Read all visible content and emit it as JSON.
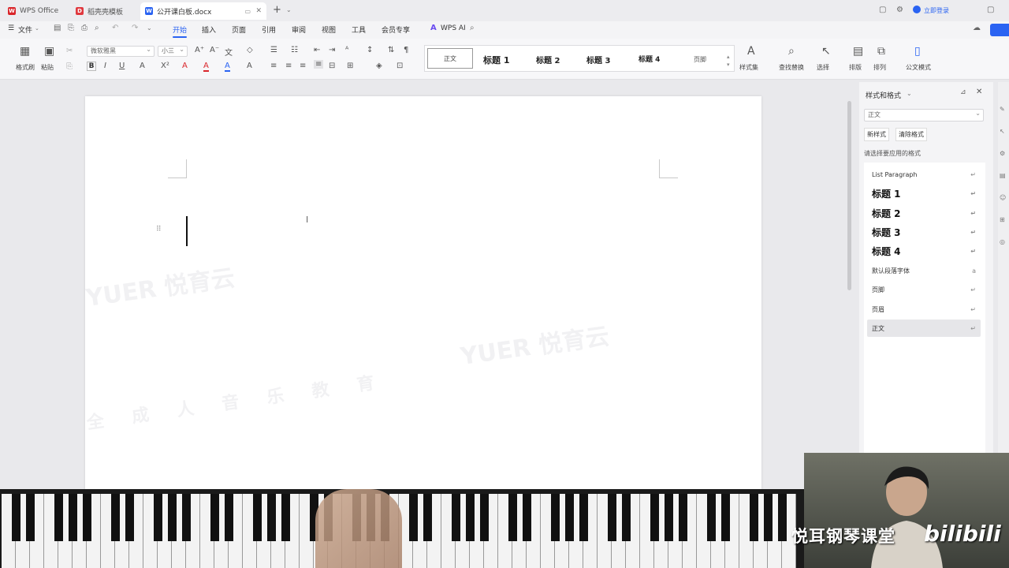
{
  "tabs": [
    {
      "label": "WPS Office",
      "icon": "wps-logo-icon",
      "color": "#d9252a"
    },
    {
      "label": "稻壳壳模板",
      "icon": "docer-icon",
      "color": "#e0383e"
    },
    {
      "label": "公开课白板.docx",
      "icon": "word-doc-icon",
      "color": "#2a63f2",
      "active": true
    }
  ],
  "window_controls": {
    "login": "立即登录"
  },
  "menu": {
    "file": "文件",
    "items": [
      "开始",
      "插入",
      "页面",
      "引用",
      "审阅",
      "视图",
      "工具",
      "会员专享"
    ],
    "active": "开始",
    "wps_ai": "WPS AI"
  },
  "ribbon": {
    "format_painter": "格式刷",
    "paste": "粘贴",
    "font_name": "微软雅黑",
    "font_size": "小三",
    "styles": [
      "正文",
      "标题 1",
      "标题 2",
      "标题 3",
      "标题 4",
      "页脚"
    ],
    "style_set": "样式集",
    "find_replace": "查找替换",
    "select": "选择",
    "sort": "排版",
    "arrange": "排列",
    "official": "公文模式"
  },
  "panel": {
    "title": "样式和格式",
    "current_style": "正文",
    "new_style": "新样式",
    "clear_format": "清除格式",
    "hint": "请选择要应用的格式",
    "items": [
      {
        "label": "List Paragraph",
        "mark": "↵"
      },
      {
        "label": "标题 1",
        "mark": "↵",
        "heading": true
      },
      {
        "label": "标题 2",
        "mark": "↵",
        "heading": true
      },
      {
        "label": "标题 3",
        "mark": "↵",
        "heading": true
      },
      {
        "label": "标题 4",
        "mark": "↵",
        "heading": true
      },
      {
        "label": "默认段落字体",
        "mark": "a"
      },
      {
        "label": "页脚",
        "mark": "↵"
      },
      {
        "label": "页眉",
        "mark": "↵"
      },
      {
        "label": "正文",
        "mark": "↵",
        "selected": true
      }
    ]
  },
  "watermarks": {
    "line1": "YUER 悦育云",
    "line2": "YUER 悦育云",
    "line3": "全 成 人 音 乐 教 育"
  },
  "overlay": {
    "channel": "悦耳钢琴课堂",
    "site": "bilibili"
  },
  "colors": {
    "accent": "#2a63f2",
    "font_red": "#d9252a",
    "font_blue": "#2a63f2"
  }
}
